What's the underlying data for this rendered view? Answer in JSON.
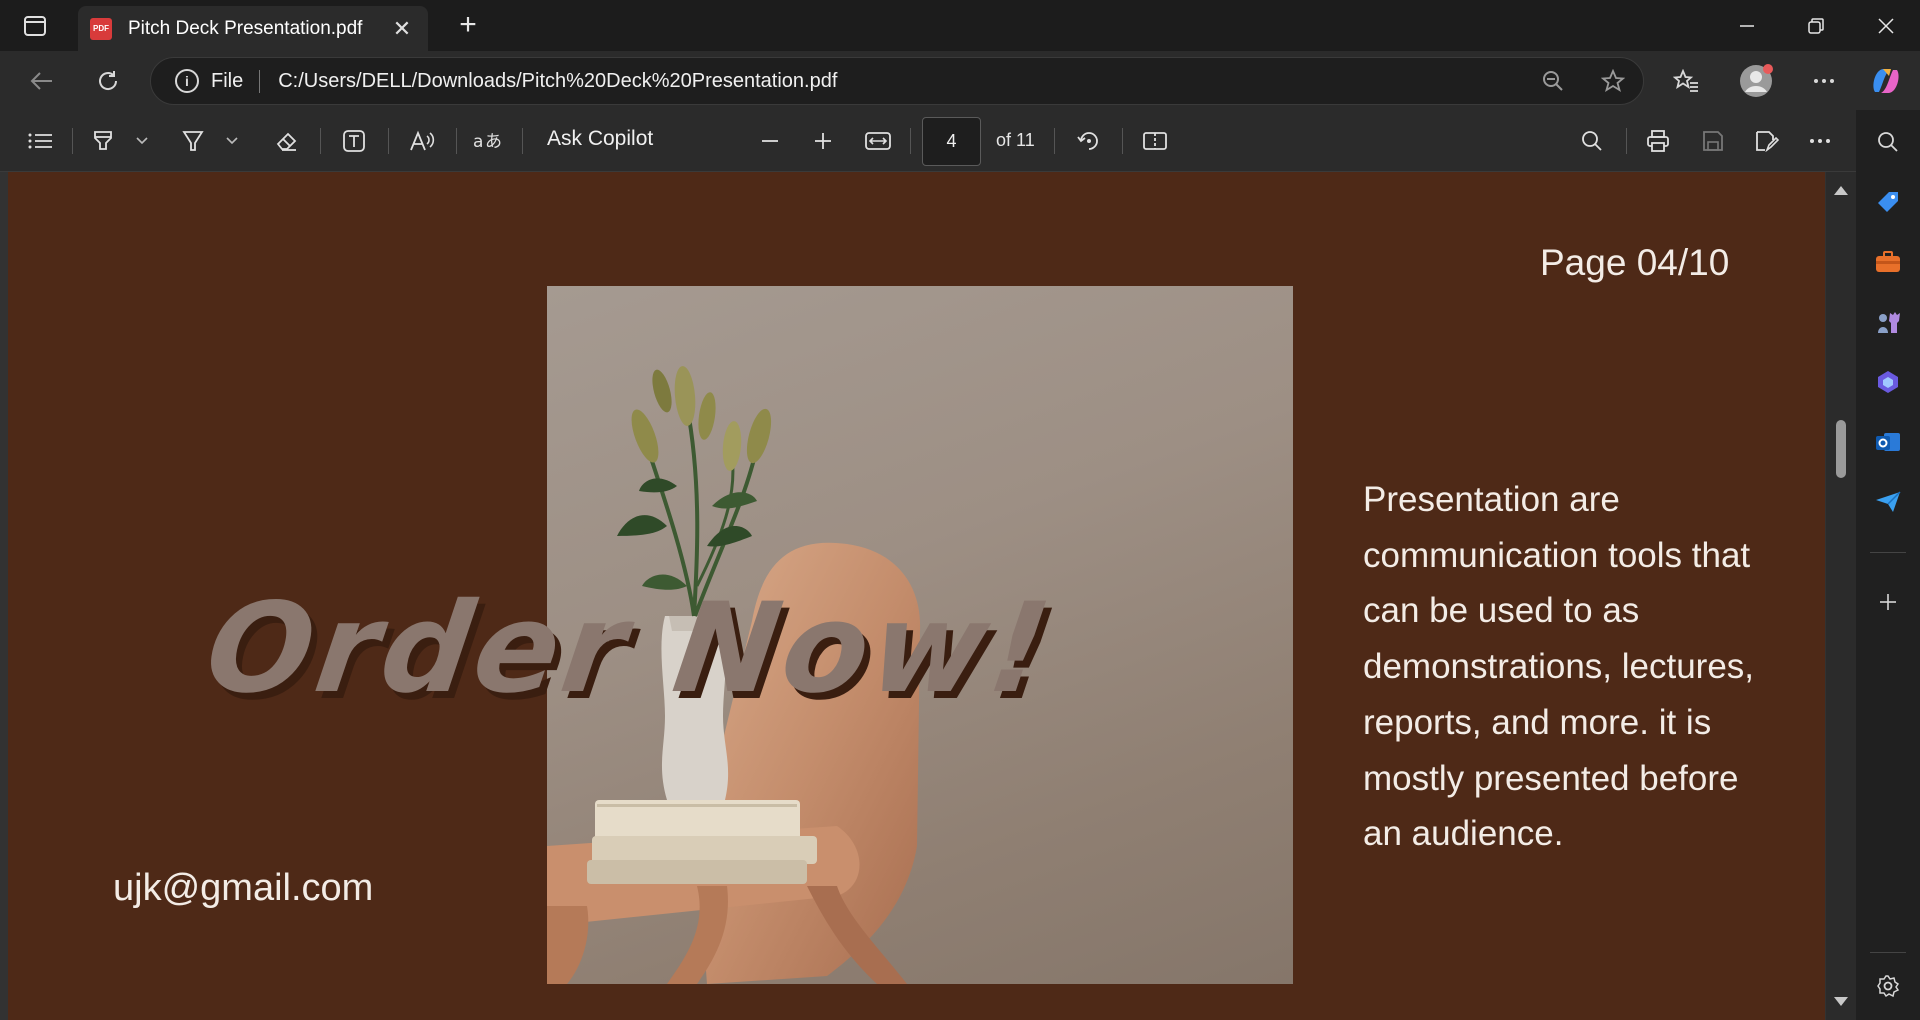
{
  "browser": {
    "tab": {
      "title": "Pitch Deck Presentation.pdf",
      "icon": "pdf-file-icon",
      "close": "✕"
    },
    "new_tab": "+",
    "window_controls": {
      "minimize": "–",
      "restore": "❐",
      "close": "✕"
    }
  },
  "address_bar": {
    "scheme_label": "File",
    "url": "C:/Users/DELL/Downloads/Pitch%20Deck%20Presentation.pdf"
  },
  "pdf_toolbar": {
    "ask_copilot": "Ask Copilot",
    "current_page": "4",
    "total_pages_label": "of 11"
  },
  "page_content": {
    "page_label": "Page 04/10",
    "headline": "Order Now!",
    "description": "Presentation are communication tools that can be used to as demonstrations, lectures, reports, and more. it is mostly presented before an audience.",
    "email": "ujk@gmail.com"
  },
  "colors": {
    "page_background": "#4e2917",
    "headline": "#8a776e",
    "text": "#f3ece6"
  },
  "sidebar": {
    "items": [
      "search-icon",
      "tag-icon",
      "briefcase-icon",
      "chess-icon",
      "copilot-icon",
      "outlook-icon",
      "send-icon",
      "add-icon",
      "settings-icon"
    ]
  }
}
